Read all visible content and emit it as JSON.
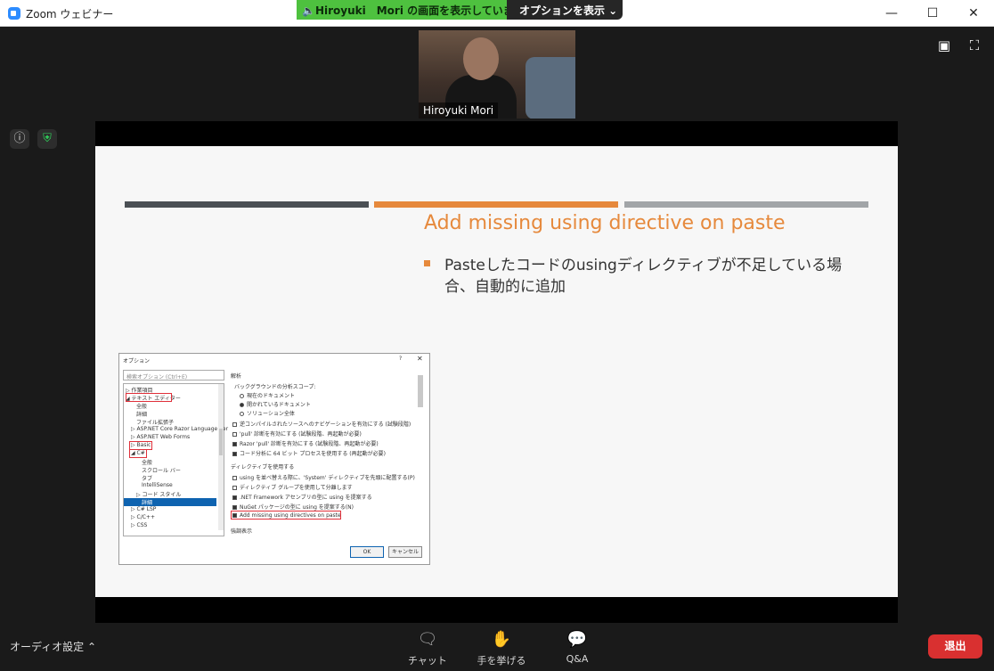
{
  "window": {
    "title": "Zoom ウェビナー",
    "minimize_icon": "minimize-icon",
    "maximize_icon": "maximize-icon",
    "close_icon": "close-icon"
  },
  "share_banner": {
    "status": "Hiroyuki　Mori の画面を表示しています",
    "options": "オプションを表示 ⌄"
  },
  "video": {
    "participant_name": "Hiroyuki Mori"
  },
  "slide": {
    "title": "Add missing using directive on paste",
    "bullet": "Pasteしたコードのusingディレクティブが不足している場合、自動的に追加"
  },
  "dialog": {
    "title": "オプション",
    "search_placeholder": "検索オプション (Ctrl+E)",
    "tree": [
      "▷ 作業項目",
      "◢ テキスト エディター",
      "全般",
      "詳細",
      "ファイル拡張子",
      "▷ ASP.NET Core Razor Language Ser",
      "▷ ASP.NET Web Forms",
      "▷ Basic",
      "◢ C#",
      "全般",
      "スクロール バー",
      "タブ",
      "IntelliSense",
      "▷ コード スタイル",
      "詳細",
      "▷ C# LSP",
      "▷ C/C++",
      "▷ CSS"
    ],
    "section_analysis": "解析",
    "background_scope": "バックグラウンドの分析スコープ:",
    "radio_current": "現在のドキュメント",
    "radio_open": "開かれているドキュメント",
    "radio_solution": "ソリューション全体",
    "opt1": "逆コンパイルされたソースへのナビゲーションを有効にする (試験段階)",
    "opt2": "'pull' 診断を有効にする (試験段階、再起動が必要)",
    "opt3": "Razor 'pull' 診断を有効にする (試験段階、再起動が必要)",
    "opt4": "コード分析に 64 ビット プロセスを使用する (再起動が必要)",
    "section_directive": "ディレクティブを使用する",
    "opt5": "using を並べ替える際に、'System' ディレクティブを先頭に配置する(P)",
    "opt6": "ディレクティブ グループを使用して分離します",
    "opt7": ".NET Framework アセンブリの型に using を提案する",
    "opt8": "NuGet パッケージの型に using を提案する(N)",
    "opt9": "Add missing using directives on paste",
    "section_highlight": "強調表示",
    "ok": "OK",
    "cancel": "キャンセル"
  },
  "toolbar": {
    "audio_settings": "オーディオ設定 ⌃",
    "chat": "チャット",
    "raise_hand": "手を挙げる",
    "qa": "Q&A",
    "leave": "退出"
  }
}
